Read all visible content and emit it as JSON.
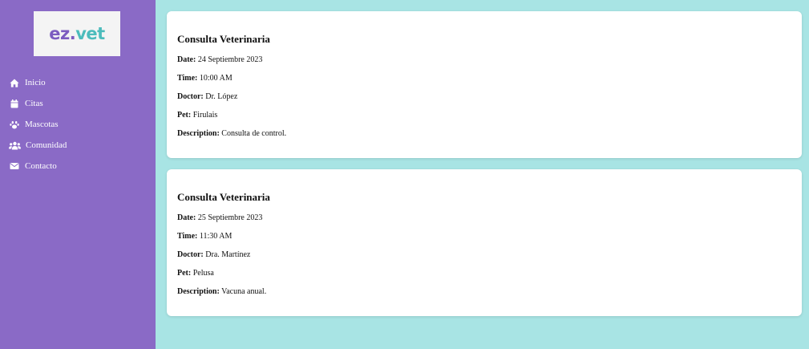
{
  "logo": {
    "part1": "ez.",
    "part2": "vet",
    "color1": "#7c5cc0",
    "color2": "#4cbcbc"
  },
  "nav": [
    {
      "label": "Inicio",
      "icon": "home-icon"
    },
    {
      "label": "Citas",
      "icon": "calendar-icon"
    },
    {
      "label": "Mascotas",
      "icon": "paw-icon"
    },
    {
      "label": "Comunidad",
      "icon": "users-icon"
    },
    {
      "label": "Contacto",
      "icon": "envelope-icon"
    }
  ],
  "labels": {
    "date": "Date:",
    "time": "Time:",
    "doctor": "Doctor:",
    "pet": "Pet:",
    "description": "Description:"
  },
  "appointments": [
    {
      "title": "Consulta Veterinaria",
      "date": "24 Septiembre 2023",
      "time": "10:00 AM",
      "doctor": "Dr. López",
      "pet": "Firulais",
      "description": "Consulta de control."
    },
    {
      "title": "Consulta Veterinaria",
      "date": "25 Septiembre 2023",
      "time": "11:30 AM",
      "doctor": "Dra. Martínez",
      "pet": "Pelusa",
      "description": "Vacuna anual."
    }
  ],
  "colors": {
    "sidebar": "#8a6ac6",
    "background": "#a8e4e4",
    "card": "#ffffff"
  }
}
